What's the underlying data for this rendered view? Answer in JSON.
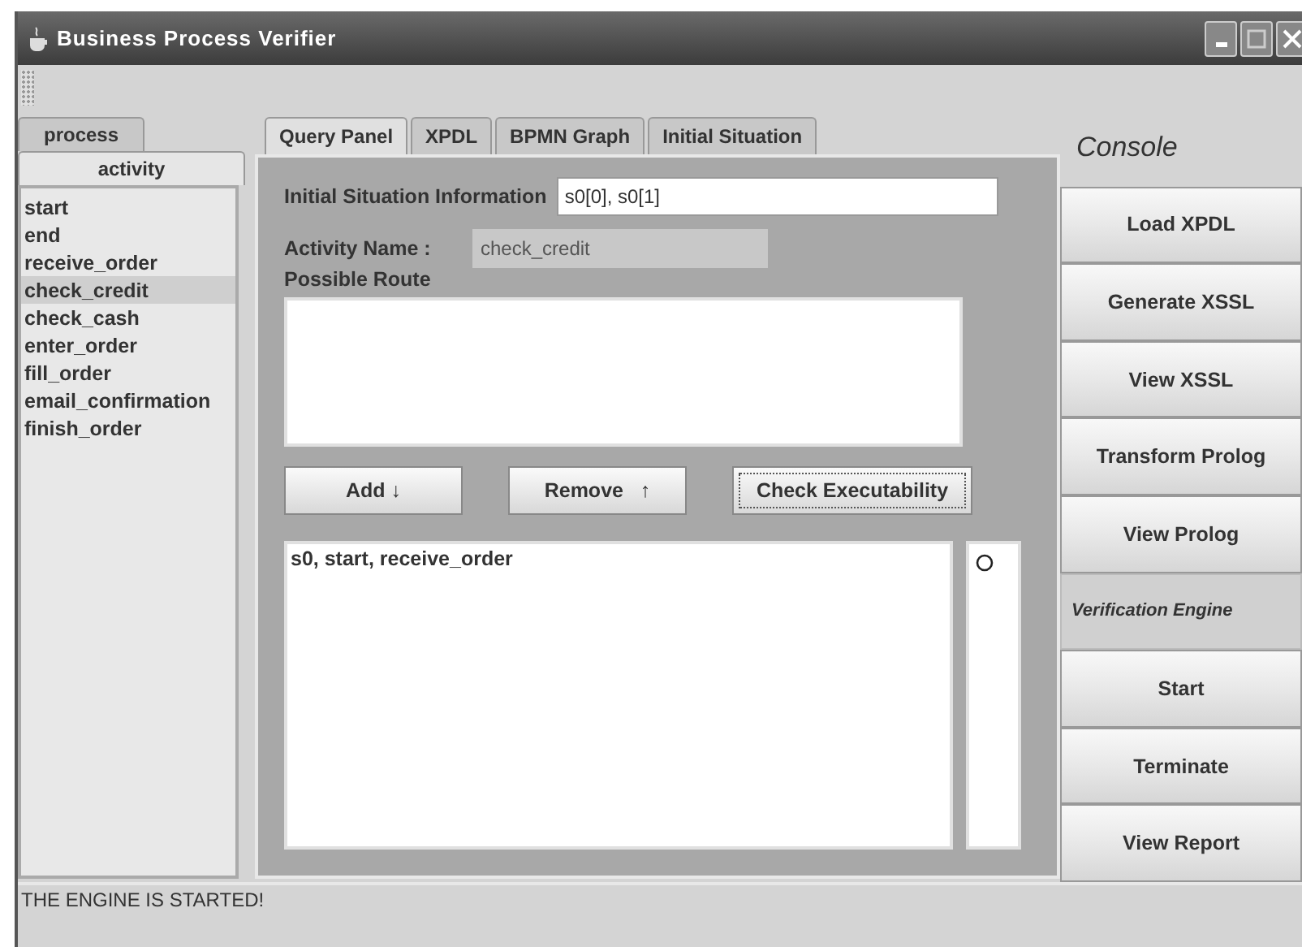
{
  "window": {
    "title": "Business Process Verifier"
  },
  "left_tabs": [
    {
      "label": "process",
      "selected": false
    },
    {
      "label": "activity",
      "selected": true
    }
  ],
  "activities": [
    {
      "label": "start",
      "selected": false
    },
    {
      "label": "end",
      "selected": false
    },
    {
      "label": "receive_order",
      "selected": false
    },
    {
      "label": "check_credit",
      "selected": true
    },
    {
      "label": "check_cash",
      "selected": false
    },
    {
      "label": "enter_order",
      "selected": false
    },
    {
      "label": "fill_order",
      "selected": false
    },
    {
      "label": "email_confirmation",
      "selected": false
    },
    {
      "label": "finish_order",
      "selected": false
    }
  ],
  "tabs": [
    {
      "label": "Query Panel",
      "selected": true
    },
    {
      "label": "XPDL",
      "selected": false
    },
    {
      "label": "BPMN Graph",
      "selected": false
    },
    {
      "label": "Initial Situation",
      "selected": false
    }
  ],
  "query_panel": {
    "initial_situation": {
      "label": "Initial Situation Information",
      "value": "s0[0], s0[1]"
    },
    "activity_name": {
      "label": "Activity Name :",
      "value": "check_credit",
      "disabled": true
    },
    "possible_route_label": "Possible Route",
    "buttons": [
      {
        "label": "Add ↓",
        "focused": false
      },
      {
        "label": "Remove   ↑",
        "focused": false
      },
      {
        "label": "Check Executability",
        "focused": true
      }
    ],
    "results": [
      "s0, start, receive_order"
    ]
  },
  "console": {
    "title": "Console",
    "items": [
      {
        "kind": "button",
        "label": "Load XPDL"
      },
      {
        "kind": "button",
        "label": "Generate XSSL"
      },
      {
        "kind": "button",
        "label": "View XSSL"
      },
      {
        "kind": "button",
        "label": "Transform Prolog"
      },
      {
        "kind": "button",
        "label": "View Prolog"
      },
      {
        "kind": "section",
        "label": "Verification Engine"
      },
      {
        "kind": "button",
        "label": "Start"
      },
      {
        "kind": "button",
        "label": "Terminate"
      },
      {
        "kind": "button",
        "label": "View Report"
      }
    ]
  },
  "status_bar": {
    "text": "THE ENGINE IS STARTED!"
  }
}
